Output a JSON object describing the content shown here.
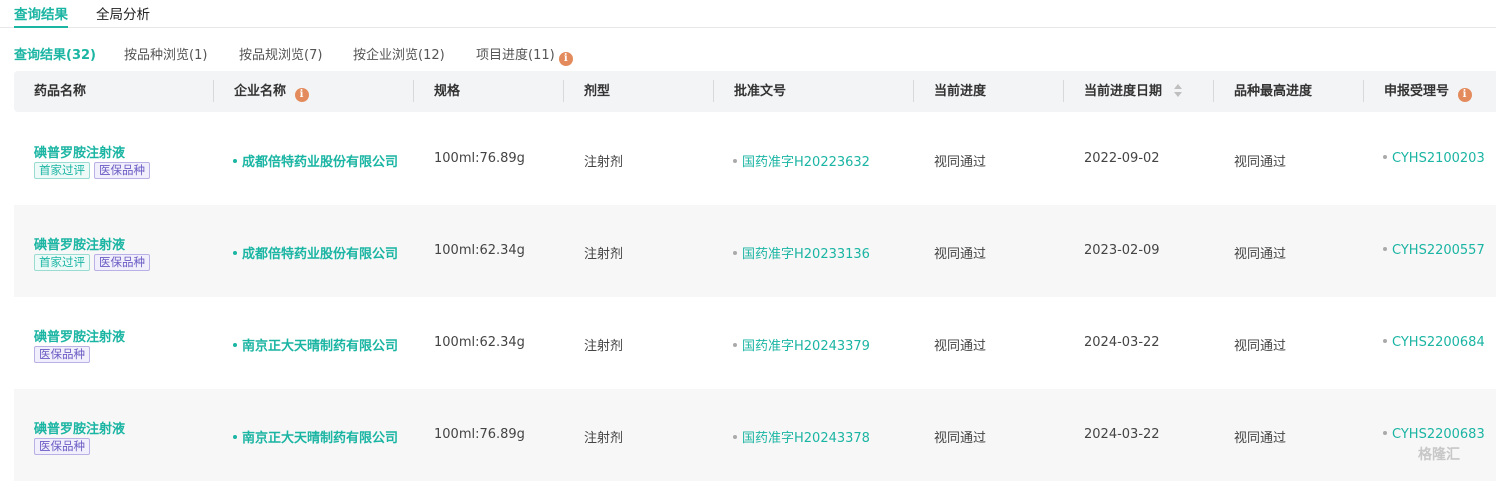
{
  "top_tabs": [
    {
      "label": "查询结果",
      "active": true
    },
    {
      "label": "全局分析",
      "active": false
    }
  ],
  "sub_tabs": [
    {
      "label": "查询结果(32)",
      "active": true
    },
    {
      "label": "按品种浏览(1)",
      "active": false
    },
    {
      "label": "按品规浏览(7)",
      "active": false
    },
    {
      "label": "按企业浏览(12)",
      "active": false
    },
    {
      "label": "项目进度(11)",
      "active": false,
      "icon": "info-icon"
    }
  ],
  "columns": [
    "药品名称",
    "企业名称",
    "规格",
    "剂型",
    "批准文号",
    "当前进度",
    "当前进度日期",
    "品种最高进度",
    "申报受理号"
  ],
  "rows": [
    {
      "drug": "碘普罗胺注射液",
      "tags": [
        "首家过评",
        "医保品种"
      ],
      "company": "成都倍特药业股份有限公司",
      "spec": "100ml:76.89g",
      "form": "注射剂",
      "approval": "国药准字H20223632",
      "progress": "视同通过",
      "date": "2022-09-02",
      "top_progress": "视同通过",
      "accept_no": "CYHS2100203"
    },
    {
      "drug": "碘普罗胺注射液",
      "tags": [
        "首家过评",
        "医保品种"
      ],
      "company": "成都倍特药业股份有限公司",
      "spec": "100ml:62.34g",
      "form": "注射剂",
      "approval": "国药准字H20233136",
      "progress": "视同通过",
      "date": "2023-02-09",
      "top_progress": "视同通过",
      "accept_no": "CYHS2200557"
    },
    {
      "drug": "碘普罗胺注射液",
      "tags": [
        "医保品种"
      ],
      "company": "南京正大天晴制药有限公司",
      "spec": "100ml:62.34g",
      "form": "注射剂",
      "approval": "国药准字H20243379",
      "progress": "视同通过",
      "date": "2024-03-22",
      "top_progress": "视同通过",
      "accept_no": "CYHS2200684"
    },
    {
      "drug": "碘普罗胺注射液",
      "tags": [
        "医保品种"
      ],
      "company": "南京正大天晴制药有限公司",
      "spec": "100ml:76.89g",
      "form": "注射剂",
      "approval": "国药准字H20243378",
      "progress": "视同通过",
      "date": "2024-03-22",
      "top_progress": "视同通过",
      "accept_no": "CYHS2200683"
    }
  ],
  "watermark": "格隆汇",
  "colors": {
    "accent": "#1bb5a3",
    "info": "#e38b5c",
    "tag_purple": "#6a5bc4"
  }
}
